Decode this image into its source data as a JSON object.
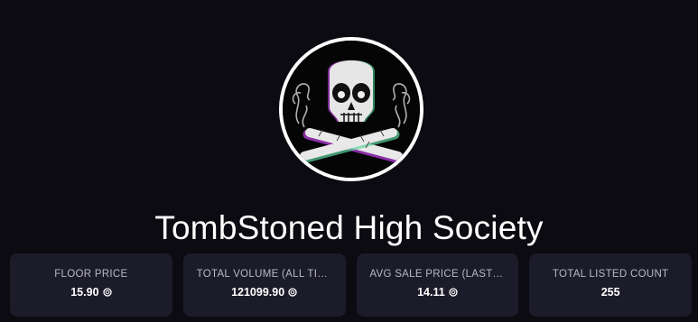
{
  "collection": {
    "title": "TombStoned High Society",
    "avatar_icon": "skull-crossed-joints-logo"
  },
  "colors": {
    "background": "#0c0b12",
    "card": "#1c1b29",
    "label": "#b9b8c8",
    "value": "#ffffff"
  },
  "stats": [
    {
      "label": "FLOOR PRICE",
      "value": "15.90",
      "currency_icon": "tezos-icon"
    },
    {
      "label": "TOTAL VOLUME (ALL TIME...",
      "value": "121099.90",
      "currency_icon": "tezos-icon"
    },
    {
      "label": "AVG SALE PRICE (LAST 24...",
      "value": "14.11",
      "currency_icon": "tezos-icon"
    },
    {
      "label": "TOTAL LISTED COUNT",
      "value": "255"
    }
  ]
}
